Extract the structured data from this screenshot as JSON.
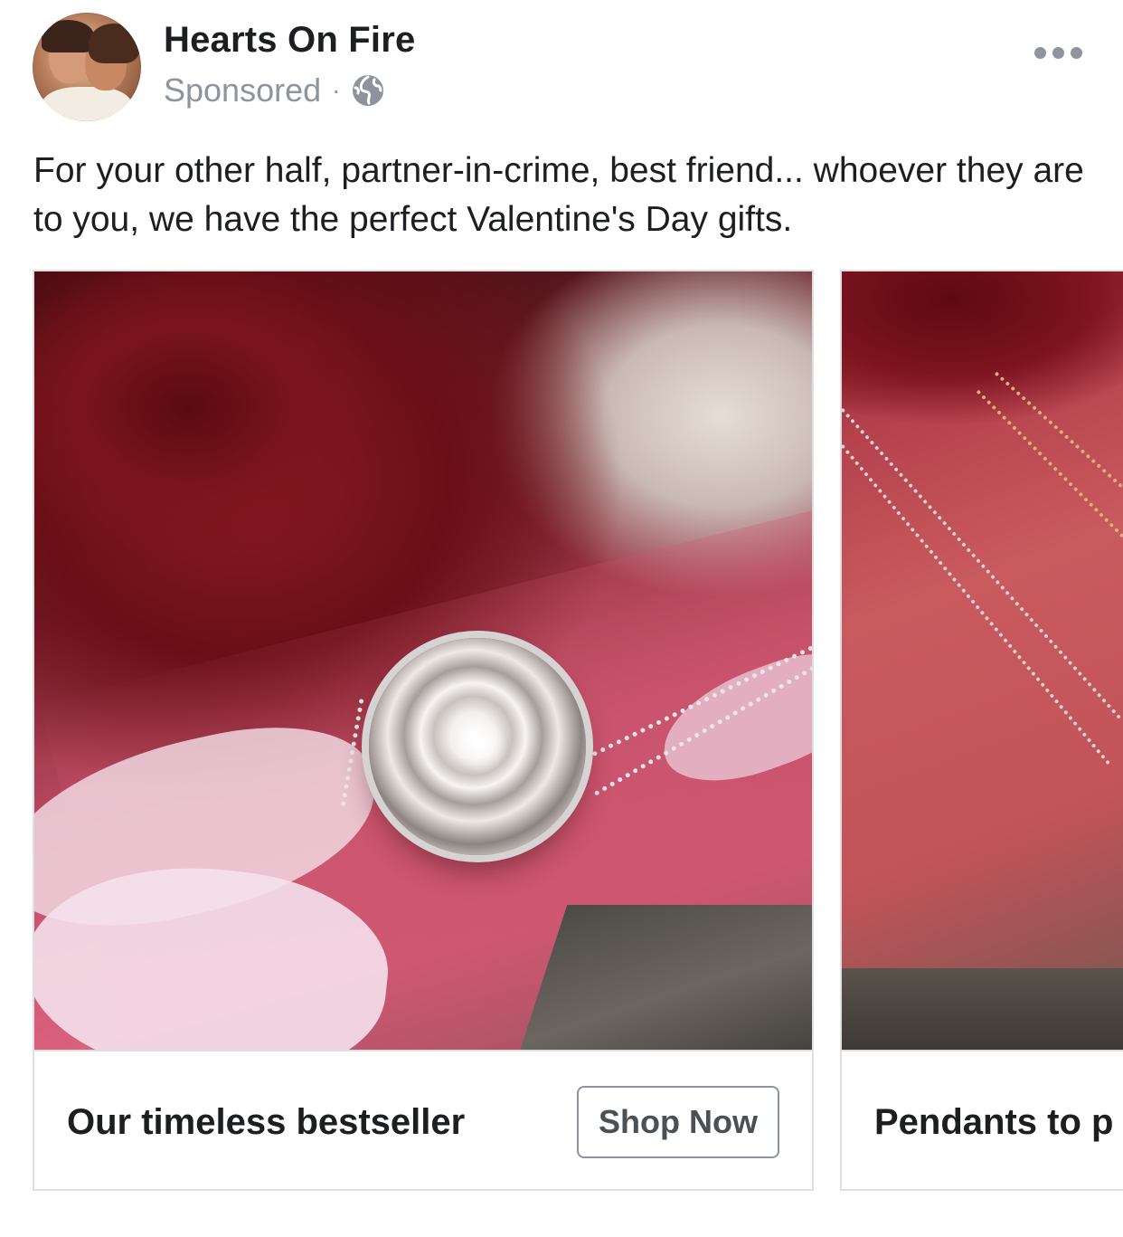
{
  "post": {
    "page_name": "Hearts On Fire",
    "sponsored_label": "Sponsored",
    "separator": "·",
    "privacy_icon": "globe-icon",
    "more_icon": "more-options-icon",
    "body_text": "For your other half, partner-in-crime, best friend... whoever they are to you, we have the perfect Valentine's Day gifts."
  },
  "carousel": {
    "cards": [
      {
        "title": "Our timeless bestseller",
        "cta_label": "Shop Now"
      },
      {
        "title": "Pendants to p"
      }
    ]
  },
  "colors": {
    "text_primary": "#1c1e21",
    "text_secondary": "#8d949e",
    "border": "#dddfe2",
    "cta_border": "#8d949e"
  }
}
